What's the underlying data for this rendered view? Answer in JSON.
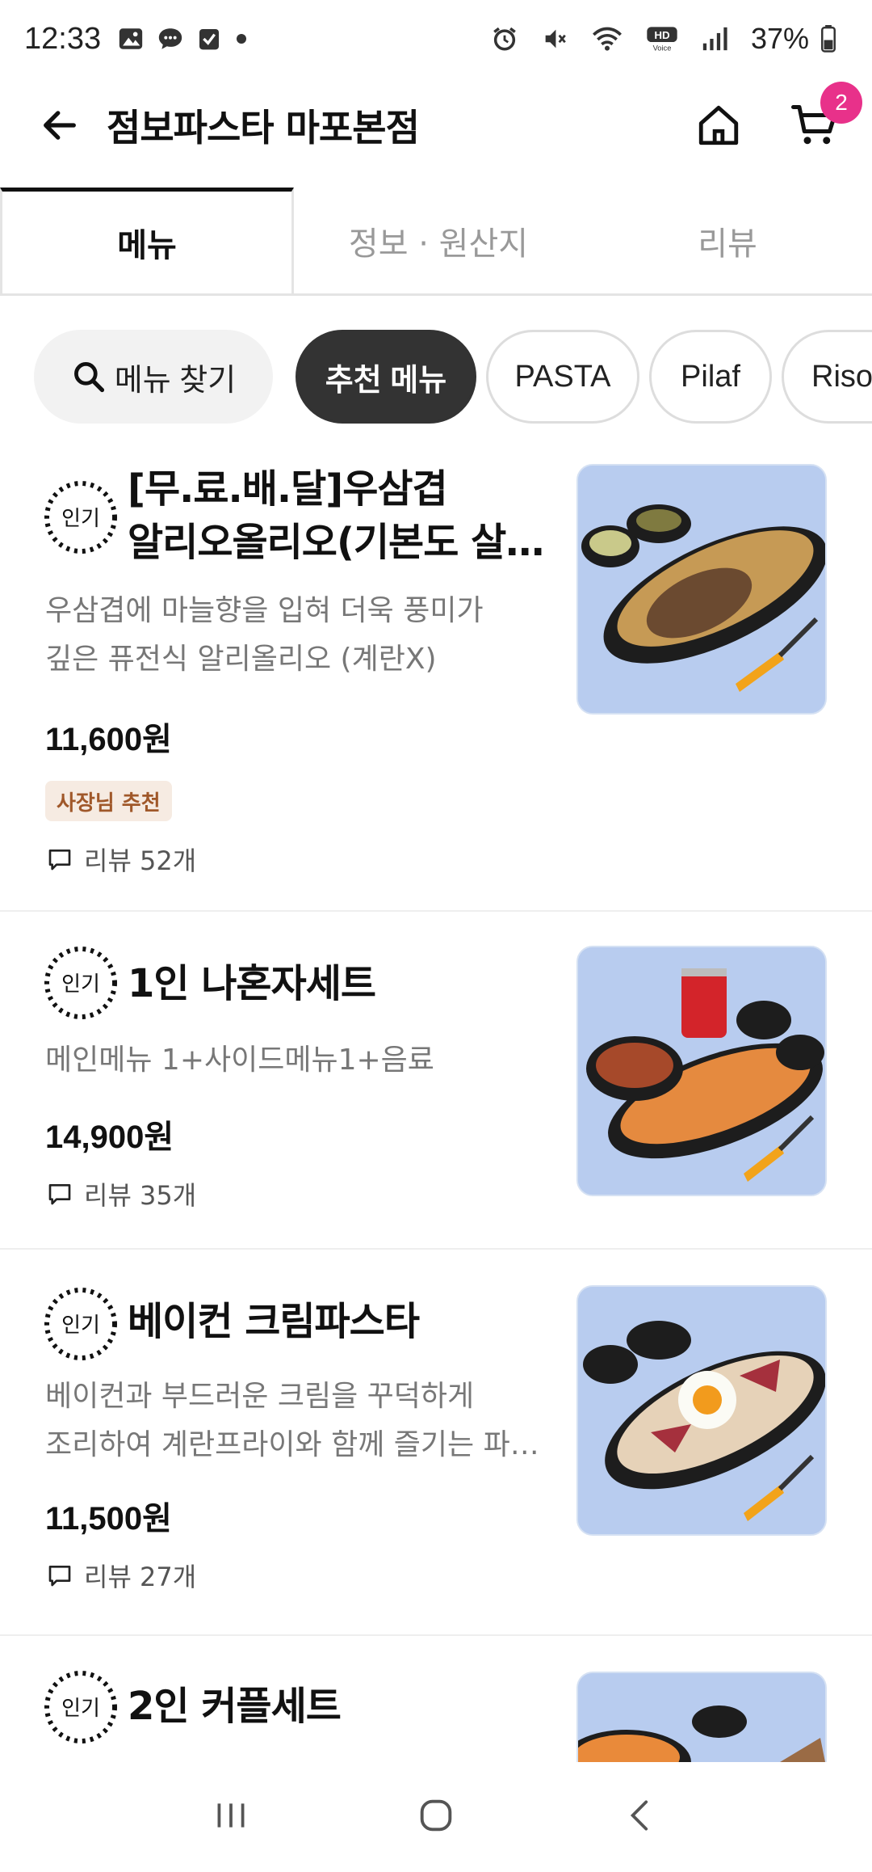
{
  "status_bar": {
    "time": "12:33",
    "battery": "37%",
    "left_icons": [
      "gallery-icon",
      "chat-icon",
      "check-icon",
      "dot-icon"
    ],
    "right_icons": [
      "alarm-icon",
      "mute-icon",
      "wifi-icon",
      "hd-voice-icon",
      "signal-icon",
      "battery-icon"
    ]
  },
  "header": {
    "title": "점보파스타 마포본점",
    "cart_count": "2"
  },
  "tabs": [
    {
      "label": "메뉴",
      "active": true
    },
    {
      "label": "정보 · 원산지",
      "active": false
    },
    {
      "label": "리뷰",
      "active": false
    }
  ],
  "chips": {
    "search_label": "메뉴 찾기",
    "items": [
      {
        "label": "추천 메뉴",
        "active": true
      },
      {
        "label": "PASTA",
        "active": false
      },
      {
        "label": "Pilaf",
        "active": false
      },
      {
        "label": "Riso",
        "active": false
      }
    ]
  },
  "popular_badge_label": "인기",
  "menu_items": [
    {
      "name_line1": "[무.료.배.달]우삼겹",
      "name_line2": "알리오올리오(기본도 살…",
      "desc_line1": "우삼겹에 마늘향을 입혀 더욱 풍미가",
      "desc_line2": "깊은 퓨전식 알리올리오 (계란X)",
      "price": "11,600원",
      "tag": "사장님 추천",
      "reviews": "리뷰 52개"
    },
    {
      "name_line1": "1인 나혼자세트",
      "desc_line1": "메인메뉴 1+사이드메뉴1+음료",
      "price": "14,900원",
      "reviews": "리뷰 35개"
    },
    {
      "name_line1": "베이컨 크림파스타",
      "desc_line1": "베이컨과 부드러운 크림을 꾸덕하게",
      "desc_line2": "조리하여 계란프라이와 함께 즐기는 파…",
      "price": "11,500원",
      "reviews": "리뷰 27개"
    },
    {
      "name_line1": "2인 커플세트"
    }
  ],
  "colors": {
    "accent_badge": "#e8318a",
    "chip_active": "#333333",
    "tag_bg": "#f6ebe2",
    "tag_text": "#a0582a",
    "photo_bg": "#b8ccef"
  }
}
